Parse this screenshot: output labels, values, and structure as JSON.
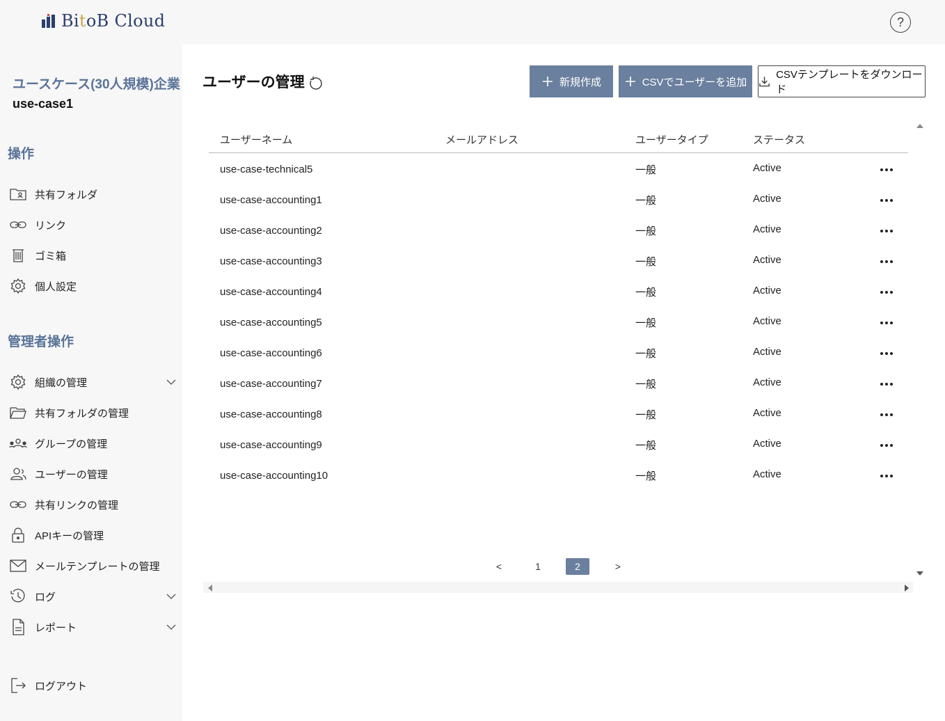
{
  "app": {
    "logo_text_pre": "Bi",
    "logo_text_accent": "t",
    "logo_text_post": "oB Cloud"
  },
  "colors": {
    "accent": "#6b7f9e",
    "section": "#5a7398",
    "brand": "#2b3f6e"
  },
  "sidebar": {
    "org_name": "ユースケース(30人規模)企業",
    "org_id": "use-case1",
    "section_ops": "操作",
    "ops_items": [
      {
        "label": "共有フォルダ",
        "icon": "shared-folder-icon"
      },
      {
        "label": "リンク",
        "icon": "link-icon"
      },
      {
        "label": "ゴミ箱",
        "icon": "trash-icon"
      },
      {
        "label": "個人設定",
        "icon": "gear-icon"
      }
    ],
    "section_admin": "管理者操作",
    "admin_items": [
      {
        "label": "組織の管理",
        "icon": "gear-icon",
        "expandable": true
      },
      {
        "label": "共有フォルダの管理",
        "icon": "folder-open-icon"
      },
      {
        "label": "グループの管理",
        "icon": "group-icon"
      },
      {
        "label": "ユーザーの管理",
        "icon": "user-icon"
      },
      {
        "label": "共有リンクの管理",
        "icon": "link-icon"
      },
      {
        "label": "APIキーの管理",
        "icon": "lock-icon"
      },
      {
        "label": "メールテンプレートの管理",
        "icon": "mail-icon"
      },
      {
        "label": "ログ",
        "icon": "clock-icon",
        "expandable": true
      },
      {
        "label": "レポート",
        "icon": "document-icon",
        "expandable": true
      }
    ],
    "logout": "ログアウト"
  },
  "main": {
    "title": "ユーザーの管理",
    "buttons": {
      "new": "新規作成",
      "csv_add": "CSVでユーザーを追加",
      "csv_template": "CSVテンプレートをダウンロード"
    },
    "table": {
      "headers": [
        "ユーザーネーム",
        "メールアドレス",
        "ユーザータイプ",
        "ステータス"
      ],
      "rows": [
        {
          "username": "use-case-technical5",
          "email": "",
          "type": "一般",
          "status": "Active"
        },
        {
          "username": "use-case-accounting1",
          "email": "",
          "type": "一般",
          "status": "Active"
        },
        {
          "username": "use-case-accounting2",
          "email": "",
          "type": "一般",
          "status": "Active"
        },
        {
          "username": "use-case-accounting3",
          "email": "",
          "type": "一般",
          "status": "Active"
        },
        {
          "username": "use-case-accounting4",
          "email": "",
          "type": "一般",
          "status": "Active"
        },
        {
          "username": "use-case-accounting5",
          "email": "",
          "type": "一般",
          "status": "Active"
        },
        {
          "username": "use-case-accounting6",
          "email": "",
          "type": "一般",
          "status": "Active"
        },
        {
          "username": "use-case-accounting7",
          "email": "",
          "type": "一般",
          "status": "Active"
        },
        {
          "username": "use-case-accounting8",
          "email": "",
          "type": "一般",
          "status": "Active"
        },
        {
          "username": "use-case-accounting9",
          "email": "",
          "type": "一般",
          "status": "Active"
        },
        {
          "username": "use-case-accounting10",
          "email": "",
          "type": "一般",
          "status": "Active"
        }
      ]
    },
    "pagination": {
      "prev": "<",
      "pages": [
        "1",
        "2"
      ],
      "current": "2",
      "next": ">"
    }
  }
}
